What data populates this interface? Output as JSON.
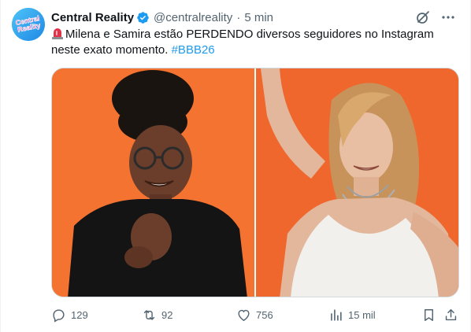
{
  "author": {
    "display_name": "Central Reality",
    "handle": "@centralreality",
    "separator": "·",
    "time": "5 min",
    "avatar_text_line1": "Central",
    "avatar_text_line2": "Reality",
    "verified": true
  },
  "tweet": {
    "text_main": "Milena e Samira estão PERDENDO diversos seguidores no Instagram neste exato momento.",
    "hashtag": "#BBB26",
    "emoji": "rotating-light"
  },
  "media": {
    "photo_left": "woman with curly hair bun and glasses on orange background",
    "photo_right": "woman with wavy blonde hair in white tank top on orange background"
  },
  "actions": {
    "replies": "129",
    "retweets": "92",
    "likes": "756",
    "views": "15 mil"
  },
  "colors": {
    "accent": "#1d9bf0",
    "muted": "#536471",
    "background_orange": "#f26b2c"
  }
}
